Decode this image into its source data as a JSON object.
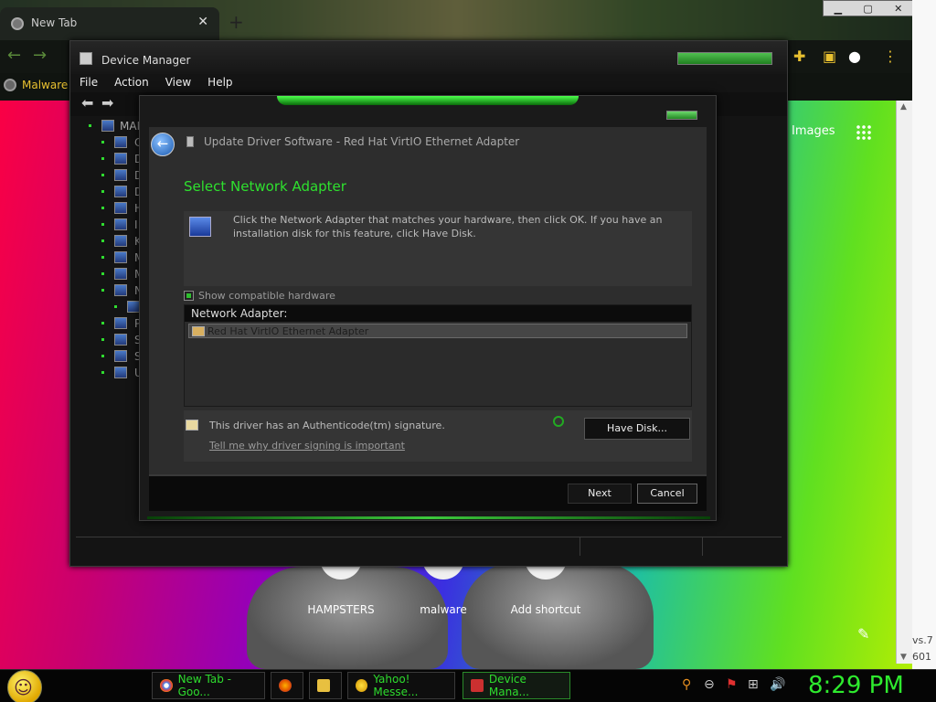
{
  "chrome": {
    "tab_title": "New Tab",
    "tab_close": "✕",
    "new_tab": "+",
    "bookmark": "Malware",
    "images_link": "Images"
  },
  "desktop": {
    "shortcuts": [
      {
        "label": "HAMPSTERS"
      },
      {
        "label": "malware"
      },
      {
        "label": "Add shortcut"
      }
    ],
    "edge_text_1": "vs.7",
    "edge_text_2": "601"
  },
  "device_manager": {
    "title": "Device Manager",
    "menu": [
      "File",
      "Action",
      "View",
      "Help"
    ],
    "tree": [
      {
        "label": "MAP"
      },
      {
        "label": "C"
      },
      {
        "label": "D"
      },
      {
        "label": "D"
      },
      {
        "label": "D"
      },
      {
        "label": "H"
      },
      {
        "label": "I"
      },
      {
        "label": "K"
      },
      {
        "label": "M"
      },
      {
        "label": "M"
      },
      {
        "label": "N"
      },
      {
        "label": ""
      },
      {
        "label": "P"
      },
      {
        "label": "S"
      },
      {
        "label": "S"
      },
      {
        "label": "U"
      }
    ]
  },
  "dialog": {
    "header": "Update Driver Software - Red Hat VirtIO Ethernet Adapter",
    "heading": "Select Network Adapter",
    "instructions": "Click the Network Adapter that matches your hardware, then click OK. If you have an installation disk for this feature, click Have Disk.",
    "show_compatible": "Show compatible hardware",
    "list_header": "Network Adapter:",
    "adapters": [
      "Red Hat VirtIO Ethernet Adapter"
    ],
    "signature_text": "This driver has an Authenticode(tm) signature.",
    "signature_link": "Tell me why driver signing is important",
    "have_disk": "Have Disk...",
    "next": "Next",
    "cancel": "Cancel"
  },
  "taskbar": {
    "tasks": [
      {
        "label": "New Tab - Goo..."
      },
      {
        "label": ""
      },
      {
        "label": ""
      },
      {
        "label": "Yahoo! Messe..."
      },
      {
        "label": "Device Mana..."
      }
    ],
    "clock": "8:29 PM"
  },
  "colors": {
    "accent_green": "#2ee02e",
    "dialog_bg": "#2d2d2d",
    "taskbar_bg": "#050505"
  }
}
